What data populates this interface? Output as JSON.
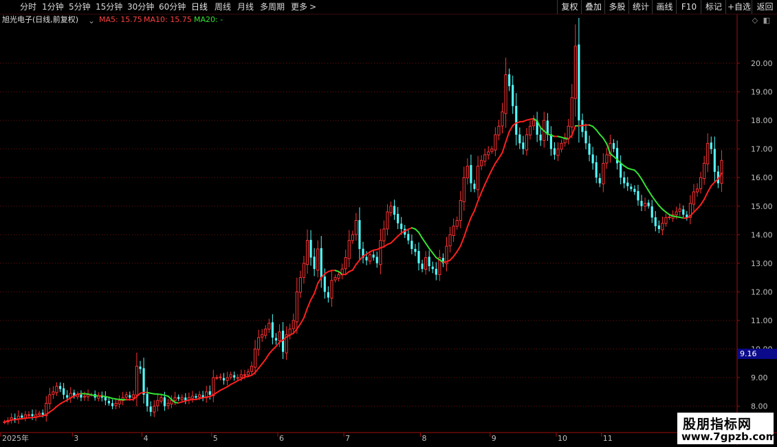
{
  "toolbar": {
    "left_tabs": [
      "分时",
      "1分钟",
      "5分钟",
      "15分钟",
      "30分钟",
      "60分钟",
      "日线",
      "周线",
      "月线",
      "多周期",
      "更多"
    ],
    "more_arrow": ">",
    "active_tab": "日线",
    "right_tabs": [
      "复权",
      "叠加",
      "多股",
      "统计",
      "画线",
      "F10",
      "标记",
      "+自选",
      "返回"
    ]
  },
  "legend": {
    "stock_title": "旭光电子(日线,前复权)",
    "ma5": "MA5: 15.75",
    "ma10": "MA10: 15.75",
    "ma20": "MA20: -"
  },
  "colors": {
    "up": "#ff3333",
    "down": "#54ffff",
    "ma_rising": "#ff2020",
    "ma_falling": "#33e233",
    "grid": "#7a1010",
    "axis": "#a01010",
    "price_label": "#c0c0c0",
    "ma5_label": "#ff4040",
    "ma10_label": "#ff4040",
    "ma20_label": "#33e233"
  },
  "current_price": "9.16",
  "watermark": {
    "line1": "股朋指标网",
    "line2": "www.7gpzb.com"
  },
  "icons": [
    "diamond-icon",
    "panel-toggle-icon"
  ],
  "chart_data": {
    "type": "candlestick",
    "y_axis_labels": [
      "20.00",
      "19.00",
      "18.00",
      "17.00",
      "16.00",
      "15.00",
      "14.00",
      "13.00",
      "12.00",
      "11.00",
      "10.00",
      "9.00",
      "8.00"
    ],
    "ylim": [
      7.1,
      21.3
    ],
    "x_axis_labels": [
      "2025年",
      "3",
      "4",
      "5",
      "6",
      "7",
      "8",
      "9",
      "10",
      "11"
    ],
    "month_start_index": [
      0,
      20,
      40,
      60,
      79,
      98,
      120,
      140,
      159,
      172
    ],
    "closes": [
      7.45,
      7.5,
      7.6,
      7.55,
      7.65,
      7.6,
      7.7,
      7.7,
      7.65,
      7.7,
      7.75,
      7.7,
      8.1,
      8.4,
      8.5,
      8.7,
      8.6,
      8.4,
      8.3,
      8.45,
      8.35,
      8.4,
      8.3,
      8.35,
      8.4,
      8.4,
      8.3,
      8.35,
      8.3,
      8.2,
      8.1,
      8.0,
      8.1,
      8.2,
      8.3,
      8.4,
      8.3,
      8.4,
      9.4,
      9.3,
      8.4,
      8.0,
      7.8,
      8.0,
      8.2,
      8.3,
      8.0,
      8.1,
      8.2,
      8.3,
      8.25,
      8.3,
      8.2,
      8.3,
      8.35,
      8.3,
      8.4,
      8.3,
      8.5,
      8.4,
      9.0,
      9.0,
      9.0,
      8.9,
      9.0,
      9.1,
      9.0,
      9.0,
      9.1,
      9.1,
      9.2,
      9.4,
      10.0,
      10.4,
      10.5,
      10.7,
      10.9,
      10.4,
      10.3,
      10.6,
      9.9,
      10.5,
      10.7,
      11.0,
      12.0,
      12.5,
      13.0,
      13.8,
      13.2,
      12.8,
      13.5,
      12.5,
      12.0,
      11.8,
      12.4,
      12.5,
      12.6,
      12.8,
      13.2,
      13.8,
      14.0,
      14.5,
      13.5,
      13.2,
      13.1,
      13.3,
      13.2,
      13.0,
      13.8,
      14.2,
      14.8,
      15.0,
      14.7,
      14.4,
      14.2,
      14.0,
      13.8,
      13.5,
      13.4,
      13.0,
      12.8,
      13.2,
      12.9,
      12.8,
      12.6,
      13.2,
      13.0,
      13.6,
      14.0,
      14.3,
      14.5,
      15.2,
      16.0,
      16.4,
      15.8,
      15.6,
      16.4,
      16.6,
      16.8,
      16.9,
      17.0,
      17.5,
      17.8,
      18.3,
      19.6,
      19.2,
      18.5,
      17.5,
      17.2,
      17.0,
      17.5,
      17.8,
      18.0,
      17.5,
      17.3,
      18.0,
      17.5,
      17.0,
      16.8,
      17.0,
      17.2,
      17.4,
      17.8,
      18.8,
      20.6,
      18.0,
      17.6,
      17.2,
      16.8,
      16.5,
      16.0,
      15.8,
      16.5,
      16.8,
      17.2,
      17.0,
      16.5,
      16.0,
      15.8,
      15.7,
      15.6,
      15.5,
      15.2,
      15.0,
      15.1,
      15.0,
      14.6,
      14.3,
      14.2,
      14.4,
      14.6,
      14.6,
      14.7,
      14.8,
      14.9,
      14.7,
      14.6,
      15.1,
      15.5,
      15.6,
      16.0,
      16.5,
      17.2,
      17.0,
      16.2,
      15.8,
      16.6
    ]
  }
}
